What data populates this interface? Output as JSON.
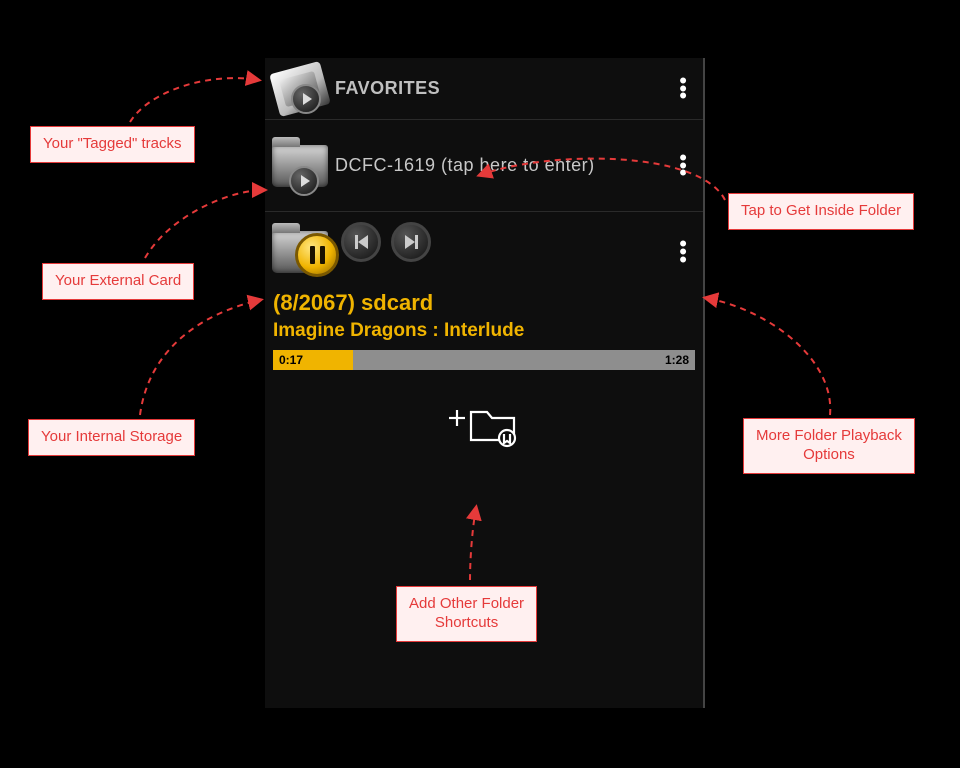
{
  "app": {
    "favorites": {
      "label": "FAVORITES"
    },
    "folder": {
      "name": "DCFC-1619 (tap here to enter)"
    },
    "nowplaying": {
      "counter": "(8/2067)  sdcard",
      "track": "Imagine Dragons : Interlude",
      "elapsed": "0:17",
      "duration": "1:28",
      "progress_pct": 19
    }
  },
  "callouts": {
    "tagged": "Your \"Tagged\" tracks",
    "external": "Your External Card",
    "internal": "Your Internal Storage",
    "enter_folder": "Tap to Get Inside Folder",
    "more_options": "More Folder Playback\nOptions",
    "add_shortcut": "Add Other Folder\nShortcuts"
  },
  "colors": {
    "accent": "#f0b400",
    "callout_red": "#e53a3a"
  }
}
